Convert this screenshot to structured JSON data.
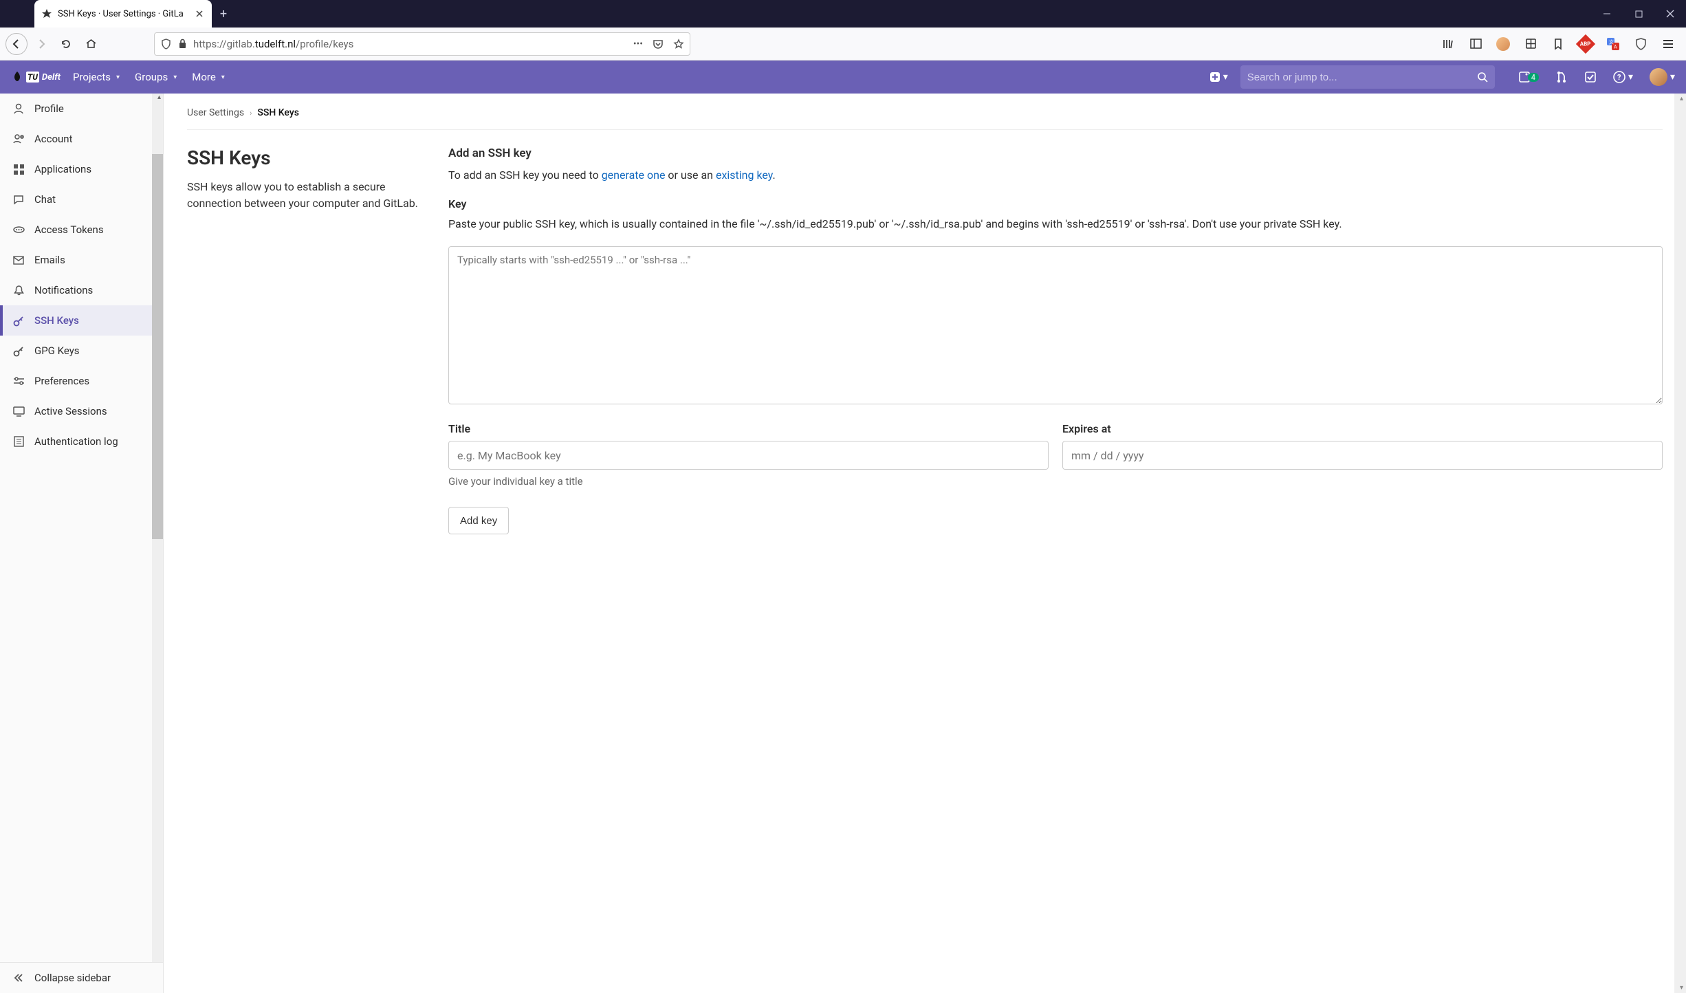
{
  "browser": {
    "tab_title": "SSH Keys · User Settings · GitLa",
    "url_prefix": "https://gitlab.",
    "url_host": "tudelft.nl",
    "url_path": "/profile/keys"
  },
  "gitlab": {
    "logo_text": "Delft",
    "nav": {
      "projects": "Projects",
      "groups": "Groups",
      "more": "More"
    },
    "search_placeholder": "Search or jump to...",
    "badge_count": "4"
  },
  "sidebar": {
    "items": [
      {
        "label": "Profile"
      },
      {
        "label": "Account"
      },
      {
        "label": "Applications"
      },
      {
        "label": "Chat"
      },
      {
        "label": "Access Tokens"
      },
      {
        "label": "Emails"
      },
      {
        "label": "Notifications"
      },
      {
        "label": "SSH Keys"
      },
      {
        "label": "GPG Keys"
      },
      {
        "label": "Preferences"
      },
      {
        "label": "Active Sessions"
      },
      {
        "label": "Authentication log"
      }
    ],
    "collapse": "Collapse sidebar"
  },
  "breadcrumbs": {
    "root": "User Settings",
    "current": "SSH Keys"
  },
  "page": {
    "title": "SSH Keys",
    "desc": "SSH keys allow you to establish a secure connection between your computer and GitLab.",
    "add_heading": "Add an SSH key",
    "add_text_pre": "To add an SSH key you need to ",
    "add_link1": "generate one",
    "add_text_mid": " or use an ",
    "add_link2": "existing key",
    "add_text_post": ".",
    "key_label": "Key",
    "key_para": "Paste your public SSH key, which is usually contained in the file '~/.ssh/id_ed25519.pub' or '~/.ssh/id_rsa.pub' and begins with 'ssh-ed25519' or 'ssh-rsa'. Don't use your private SSH key.",
    "key_placeholder": "Typically starts with \"ssh-ed25519 ...\" or \"ssh-rsa ...\"",
    "title_label": "Title",
    "title_placeholder": "e.g. My MacBook key",
    "title_help": "Give your individual key a title",
    "expires_label": "Expires at",
    "expires_placeholder": "mm / dd / yyyy",
    "submit": "Add key"
  }
}
